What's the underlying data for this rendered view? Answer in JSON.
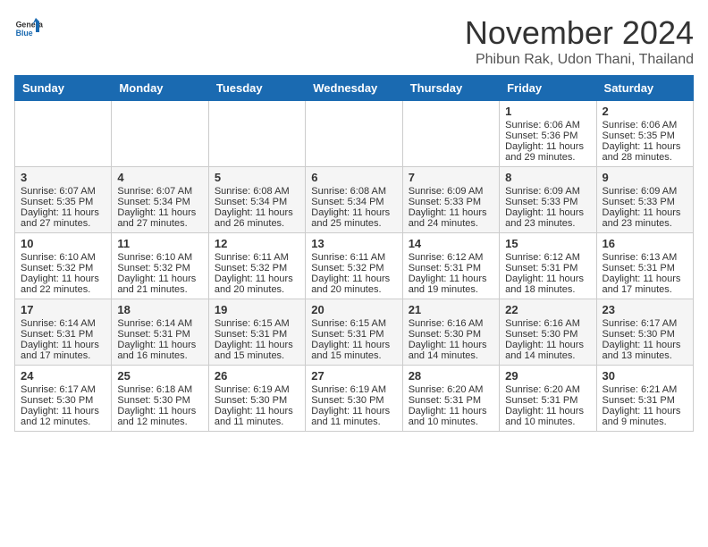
{
  "header": {
    "logo_general": "General",
    "logo_blue": "Blue",
    "title": "November 2024",
    "subtitle": "Phibun Rak, Udon Thani, Thailand"
  },
  "days_of_week": [
    "Sunday",
    "Monday",
    "Tuesday",
    "Wednesday",
    "Thursday",
    "Friday",
    "Saturday"
  ],
  "weeks": [
    [
      {
        "day": "",
        "info": ""
      },
      {
        "day": "",
        "info": ""
      },
      {
        "day": "",
        "info": ""
      },
      {
        "day": "",
        "info": ""
      },
      {
        "day": "",
        "info": ""
      },
      {
        "day": "1",
        "info": "Sunrise: 6:06 AM\nSunset: 5:36 PM\nDaylight: 11 hours and 29 minutes."
      },
      {
        "day": "2",
        "info": "Sunrise: 6:06 AM\nSunset: 5:35 PM\nDaylight: 11 hours and 28 minutes."
      }
    ],
    [
      {
        "day": "3",
        "info": "Sunrise: 6:07 AM\nSunset: 5:35 PM\nDaylight: 11 hours and 27 minutes."
      },
      {
        "day": "4",
        "info": "Sunrise: 6:07 AM\nSunset: 5:34 PM\nDaylight: 11 hours and 27 minutes."
      },
      {
        "day": "5",
        "info": "Sunrise: 6:08 AM\nSunset: 5:34 PM\nDaylight: 11 hours and 26 minutes."
      },
      {
        "day": "6",
        "info": "Sunrise: 6:08 AM\nSunset: 5:34 PM\nDaylight: 11 hours and 25 minutes."
      },
      {
        "day": "7",
        "info": "Sunrise: 6:09 AM\nSunset: 5:33 PM\nDaylight: 11 hours and 24 minutes."
      },
      {
        "day": "8",
        "info": "Sunrise: 6:09 AM\nSunset: 5:33 PM\nDaylight: 11 hours and 23 minutes."
      },
      {
        "day": "9",
        "info": "Sunrise: 6:09 AM\nSunset: 5:33 PM\nDaylight: 11 hours and 23 minutes."
      }
    ],
    [
      {
        "day": "10",
        "info": "Sunrise: 6:10 AM\nSunset: 5:32 PM\nDaylight: 11 hours and 22 minutes."
      },
      {
        "day": "11",
        "info": "Sunrise: 6:10 AM\nSunset: 5:32 PM\nDaylight: 11 hours and 21 minutes."
      },
      {
        "day": "12",
        "info": "Sunrise: 6:11 AM\nSunset: 5:32 PM\nDaylight: 11 hours and 20 minutes."
      },
      {
        "day": "13",
        "info": "Sunrise: 6:11 AM\nSunset: 5:32 PM\nDaylight: 11 hours and 20 minutes."
      },
      {
        "day": "14",
        "info": "Sunrise: 6:12 AM\nSunset: 5:31 PM\nDaylight: 11 hours and 19 minutes."
      },
      {
        "day": "15",
        "info": "Sunrise: 6:12 AM\nSunset: 5:31 PM\nDaylight: 11 hours and 18 minutes."
      },
      {
        "day": "16",
        "info": "Sunrise: 6:13 AM\nSunset: 5:31 PM\nDaylight: 11 hours and 17 minutes."
      }
    ],
    [
      {
        "day": "17",
        "info": "Sunrise: 6:14 AM\nSunset: 5:31 PM\nDaylight: 11 hours and 17 minutes."
      },
      {
        "day": "18",
        "info": "Sunrise: 6:14 AM\nSunset: 5:31 PM\nDaylight: 11 hours and 16 minutes."
      },
      {
        "day": "19",
        "info": "Sunrise: 6:15 AM\nSunset: 5:31 PM\nDaylight: 11 hours and 15 minutes."
      },
      {
        "day": "20",
        "info": "Sunrise: 6:15 AM\nSunset: 5:31 PM\nDaylight: 11 hours and 15 minutes."
      },
      {
        "day": "21",
        "info": "Sunrise: 6:16 AM\nSunset: 5:30 PM\nDaylight: 11 hours and 14 minutes."
      },
      {
        "day": "22",
        "info": "Sunrise: 6:16 AM\nSunset: 5:30 PM\nDaylight: 11 hours and 14 minutes."
      },
      {
        "day": "23",
        "info": "Sunrise: 6:17 AM\nSunset: 5:30 PM\nDaylight: 11 hours and 13 minutes."
      }
    ],
    [
      {
        "day": "24",
        "info": "Sunrise: 6:17 AM\nSunset: 5:30 PM\nDaylight: 11 hours and 12 minutes."
      },
      {
        "day": "25",
        "info": "Sunrise: 6:18 AM\nSunset: 5:30 PM\nDaylight: 11 hours and 12 minutes."
      },
      {
        "day": "26",
        "info": "Sunrise: 6:19 AM\nSunset: 5:30 PM\nDaylight: 11 hours and 11 minutes."
      },
      {
        "day": "27",
        "info": "Sunrise: 6:19 AM\nSunset: 5:30 PM\nDaylight: 11 hours and 11 minutes."
      },
      {
        "day": "28",
        "info": "Sunrise: 6:20 AM\nSunset: 5:31 PM\nDaylight: 11 hours and 10 minutes."
      },
      {
        "day": "29",
        "info": "Sunrise: 6:20 AM\nSunset: 5:31 PM\nDaylight: 11 hours and 10 minutes."
      },
      {
        "day": "30",
        "info": "Sunrise: 6:21 AM\nSunset: 5:31 PM\nDaylight: 11 hours and 9 minutes."
      }
    ]
  ]
}
